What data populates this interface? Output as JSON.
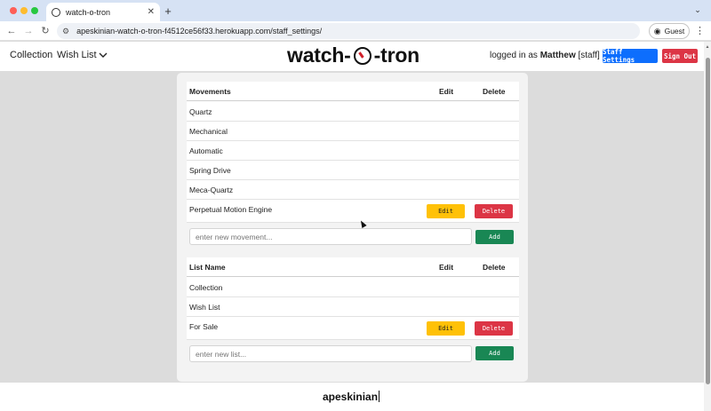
{
  "browser": {
    "tab_title": "watch-o-tron",
    "url_host": "apeskinian-watch-o-tron-f4512ce56f33.herokuapp.com",
    "url_path": "/staff_settings/",
    "guest_label": "Guest"
  },
  "header": {
    "nav": [
      "Collection",
      "Wish List"
    ],
    "logo_left": "watch-",
    "logo_right": "-tron",
    "logged_prefix": "logged in as",
    "user": "Matthew",
    "role": "[staff]",
    "staff_settings_label": "Staff Settings",
    "sign_out_label": "Sign Out",
    "staff_settings_color": "#0d6efd",
    "sign_out_color": "#dc3545"
  },
  "movements": {
    "header": {
      "name": "Movements",
      "edit": "Edit",
      "delete": "Delete"
    },
    "rows": [
      "Quartz",
      "Mechanical",
      "Automatic",
      "Spring Drive",
      "Meca-Quartz",
      "Perpetual Motion Engine"
    ],
    "edit_label": "Edit",
    "delete_label": "Delete",
    "input_placeholder": "enter new movement...",
    "add_label": "Add"
  },
  "lists": {
    "header": {
      "name": "List Name",
      "edit": "Edit",
      "delete": "Delete"
    },
    "rows": [
      "Collection",
      "Wish List",
      "For Sale"
    ],
    "edit_label": "Edit",
    "delete_label": "Delete",
    "input_placeholder": "enter new list...",
    "add_label": "Add"
  },
  "footer": {
    "text": "apeskinian"
  }
}
